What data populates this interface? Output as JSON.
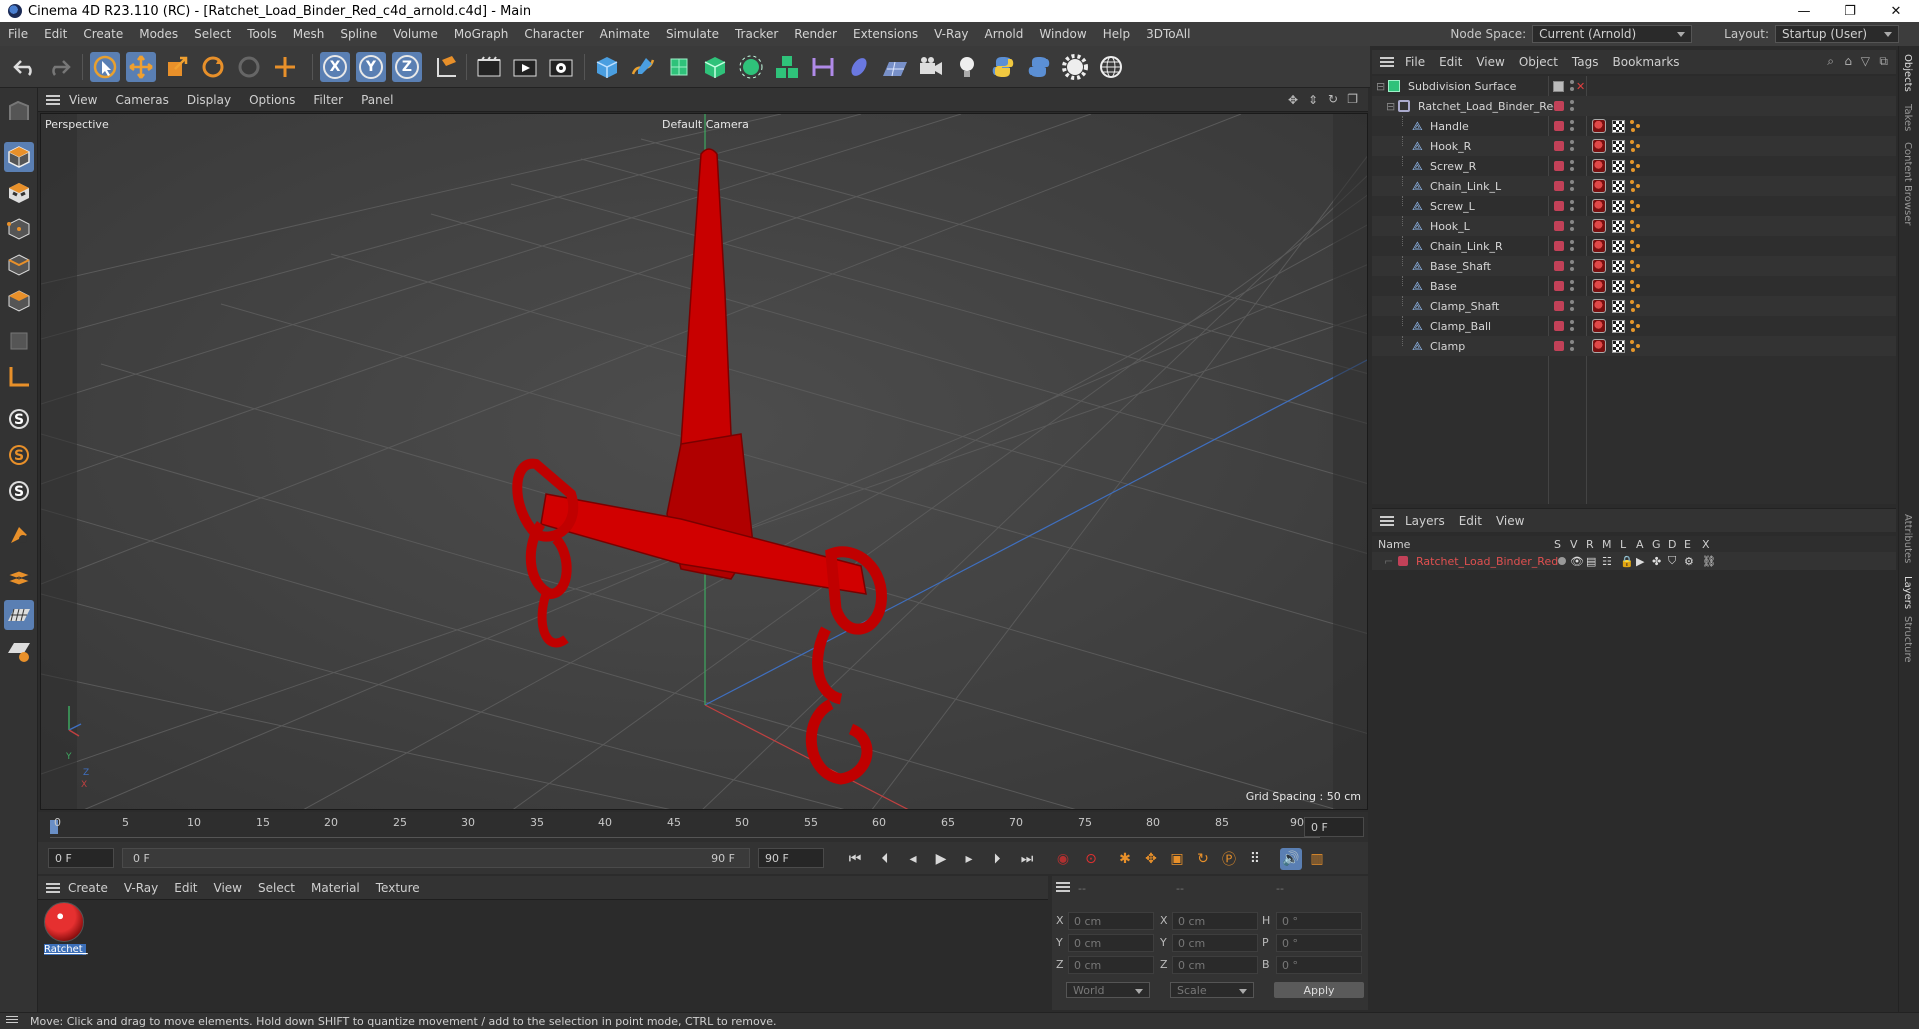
{
  "window": {
    "title": "Cinema 4D R23.110 (RC) - [Ratchet_Load_Binder_Red_c4d_arnold.c4d] - Main",
    "controls": [
      "—",
      "❐",
      "✕"
    ]
  },
  "menubar": {
    "items": [
      "File",
      "Edit",
      "Create",
      "Modes",
      "Select",
      "Tools",
      "Mesh",
      "Spline",
      "Volume",
      "MoGraph",
      "Character",
      "Animate",
      "Simulate",
      "Tracker",
      "Render",
      "Extensions",
      "V-Ray",
      "Arnold",
      "Window",
      "Help",
      "3DToAll"
    ],
    "node_space_label": "Node Space:",
    "node_space_value": "Current (Arnold)",
    "layout_label": "Layout:",
    "layout_value": "Startup (User)"
  },
  "toolbar": {
    "axis_x": "X",
    "axis_y": "Y",
    "axis_z": "Z"
  },
  "viewport": {
    "menu": [
      "View",
      "Cameras",
      "Display",
      "Options",
      "Filter",
      "Panel"
    ],
    "projection": "Perspective",
    "camera": "Default Camera",
    "grid_spacing": "Grid Spacing : 50 cm",
    "axis_y": "Y",
    "axis_z": "Z",
    "axis_x": "X"
  },
  "timeline": {
    "ticks": [
      "0",
      "5",
      "10",
      "15",
      "20",
      "25",
      "30",
      "35",
      "40",
      "45",
      "50",
      "55",
      "60",
      "65",
      "70",
      "75",
      "80",
      "85",
      "90"
    ],
    "current_frame_right": "0 F",
    "start": "0 F",
    "range_start": "0 F",
    "range_end": "90 F",
    "end": "90 F"
  },
  "material_manager": {
    "menu": [
      "Create",
      "V-Ray",
      "Edit",
      "View",
      "Select",
      "Material",
      "Texture"
    ],
    "material_name": "Ratchet_"
  },
  "coordinates": {
    "headers": [
      "--",
      "--",
      "--"
    ],
    "pos_labels": [
      "X",
      "Y",
      "Z"
    ],
    "size_labels": [
      "X",
      "Y",
      "Z"
    ],
    "rot_labels": [
      "H",
      "P",
      "B"
    ],
    "pos_values": [
      "0 cm",
      "0 cm",
      "0 cm"
    ],
    "size_values": [
      "0 cm",
      "0 cm",
      "0 cm"
    ],
    "rot_values": [
      "0 °",
      "0 °",
      "0 °"
    ],
    "mode_world": "World",
    "mode_scale": "Scale",
    "apply": "Apply"
  },
  "object_manager": {
    "menu": [
      "File",
      "Edit",
      "View",
      "Object",
      "Tags",
      "Bookmarks"
    ],
    "root": "Subdivision Surface",
    "group": "Ratchet_Load_Binder_Red",
    "children": [
      "Handle",
      "Hook_R",
      "Screw_R",
      "Chain_Link_L",
      "Screw_L",
      "Hook_L",
      "Chain_Link_R",
      "Base_Shaft",
      "Base",
      "Clamp_Shaft",
      "Clamp_Ball",
      "Clamp"
    ]
  },
  "layers": {
    "menu": [
      "Layers",
      "Edit",
      "View"
    ],
    "col_name": "Name",
    "cols": [
      "S",
      "V",
      "R",
      "M",
      "L",
      "A",
      "G",
      "D",
      "E",
      "X"
    ],
    "rows": [
      "Ratchet_Load_Binder_Red"
    ]
  },
  "side_tabs": [
    "Objects",
    "Takes",
    "Content Browser",
    "Attributes",
    "Layers",
    "Structure"
  ],
  "status": "Move: Click and drag to move elements. Hold down SHIFT to quantize movement / add to the selection in point mode, CTRL to remove.",
  "colors": {
    "accent": "#5a7fb3",
    "object_red": "#c00000",
    "layer_red": "#c24158"
  }
}
